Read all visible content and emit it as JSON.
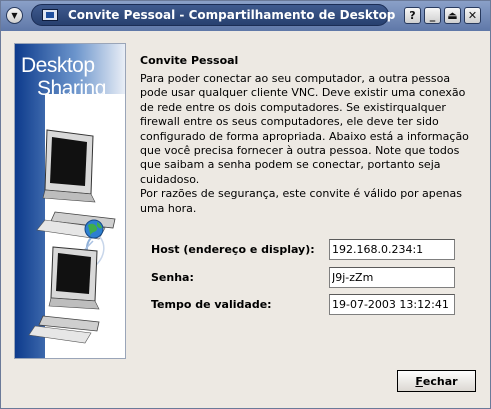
{
  "window": {
    "title": "Convite Pessoal - Compartilhamento de Desktop",
    "controls": {
      "help": "?",
      "minimize": "_",
      "shade": "⏏",
      "close": "✕"
    },
    "menu_icon": "▼"
  },
  "side_panel": {
    "logo_line1": "Desktop",
    "logo_line2": "Sharing"
  },
  "content": {
    "heading": "Convite Pessoal",
    "paragraph1": "Para poder conectar ao seu computador, a outra pessoa pode usar qualquer cliente VNC. Deve existir uma conexão de rede entre os dois computadores. Se existirqualquer firewall entre os seus computadores, ele deve ter sido configurado de forma apropriada. Abaixo está a informação que você precisa fornecer à outra pessoa. Note que todos que saibam a senha podem se conectar, portanto seja cuidadoso.",
    "paragraph2": "Por razões de segurança, este convite é válido por apenas uma hora."
  },
  "fields": {
    "host_label": "Host (endereço e display):",
    "host_value": "192.168.0.234:1",
    "password_label": "Senha:",
    "password_value": "J9j-zZm",
    "validity_label": "Tempo de validade:",
    "validity_value": "19-07-2003 13:12:41"
  },
  "buttons": {
    "close_prefix": "F",
    "close_rest": "echar"
  }
}
